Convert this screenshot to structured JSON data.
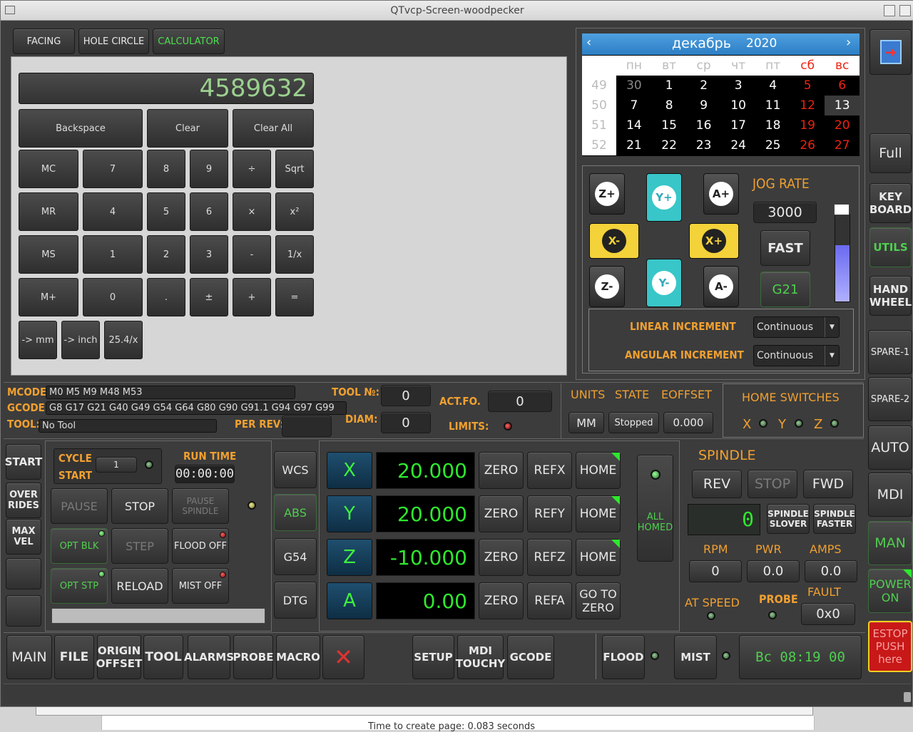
{
  "window": {
    "title": "QTvcp-Screen-woodpecker"
  },
  "tabs": [
    "FACING",
    "HOLE CIRCLE",
    "CALCULATOR"
  ],
  "calculator": {
    "display": "4589632",
    "keys": [
      [
        "Backspace",
        "Clear",
        "Clear All"
      ],
      [
        "MC",
        "7",
        "8",
        "9",
        "÷",
        "Sqrt"
      ],
      [
        "MR",
        "4",
        "5",
        "6",
        "×",
        "x²"
      ],
      [
        "MS",
        "1",
        "2",
        "3",
        "-",
        "1/x"
      ],
      [
        "M+",
        "0",
        ".",
        "±",
        "+",
        "="
      ],
      [
        "-> mm",
        "-> inch",
        "25.4/x"
      ]
    ]
  },
  "calendar": {
    "month": "декабрь",
    "year": "2020",
    "weekdays": [
      "пн",
      "вт",
      "ср",
      "чт",
      "пт",
      "сб",
      "вс"
    ],
    "weeks": [
      {
        "n": "49",
        "d": [
          "30",
          "1",
          "2",
          "3",
          "4",
          "5",
          "6"
        ]
      },
      {
        "n": "50",
        "d": [
          "7",
          "8",
          "9",
          "10",
          "11",
          "12",
          "13"
        ]
      },
      {
        "n": "51",
        "d": [
          "14",
          "15",
          "16",
          "17",
          "18",
          "19",
          "20"
        ]
      },
      {
        "n": "52",
        "d": [
          "21",
          "22",
          "23",
          "24",
          "25",
          "26",
          "27"
        ]
      }
    ]
  },
  "jog": {
    "buttons": {
      "zp": "Z+",
      "yp": "Y+",
      "ap": "A+",
      "xm": "X-",
      "xp": "X+",
      "zm": "Z-",
      "ym": "Y-",
      "am": "A-"
    },
    "rate_label": "JOG RATE",
    "rate": "3000",
    "fast": "FAST",
    "g21": "G21",
    "linear_label": "LINEAR INCREMENT",
    "linear": "Continuous",
    "angular_label": "ANGULAR INCREMENT",
    "angular": "Continuous",
    "slider_level": 0.85
  },
  "right": {
    "full": "Full",
    "keyboard": "KEY BOARD",
    "utils": "UTILS",
    "handwheel": "HAND WHEEL",
    "spare1": "SPARE-1",
    "spare2": "SPARE-2",
    "auto": "AUTO",
    "mdi": "MDI",
    "man": "MAN",
    "power": "POWER ON",
    "estop": "ESTOP PUSH here"
  },
  "status": {
    "mcodes_label": "MCODES:",
    "mcodes": "M0 M5 M9 M48 M53",
    "gcodes_label": "GCODES:",
    "gcodes": "G8 G17 G21 G40 G49 G54 G64 G80 G90 G91.1 G94 G97 G99",
    "tool_label": "TOOL:",
    "tool": "No Tool",
    "toolno_label": "TOOL №:",
    "toolno": "0",
    "diam_label": "DIAM:",
    "diam": "0",
    "perrev_label": "PER REV:",
    "perrev": "",
    "actfo_label": "ACT.FO.",
    "actfo": "0",
    "limits_label": "LIMITS:",
    "units_label": "UNITS",
    "state_label": "STATE",
    "eoffset_label": "EOFFSET",
    "units": "MM",
    "state": "Stopped",
    "eoffset": "0.000",
    "home_label": "HOME SWITCHES",
    "home_axes": [
      "X",
      "Y",
      "Z"
    ]
  },
  "left": {
    "start": "START",
    "overrides": "OVER RIDES",
    "maxvel": "MAX VEL"
  },
  "cycle": {
    "cycle_start": "CYCLE START",
    "count": "1",
    "run_time_label": "RUN TIME",
    "run_time": "00:00:00",
    "pause": "PAUSE",
    "stop": "STOP",
    "pause_spindle": "PAUSE SPINDLE",
    "opt_blk": "OPT BLK",
    "step": "STEP",
    "flood_off": "FLOOD OFF",
    "opt_stp": "OPT STP",
    "reload": "RELOAD",
    "mist_off": "MIST OFF"
  },
  "coords": [
    "WCS",
    "ABS",
    "G54",
    "DTG"
  ],
  "dro": [
    {
      "axis": "X",
      "value": "20.000",
      "ref": "REFX",
      "home": "HOME"
    },
    {
      "axis": "Y",
      "value": "20.000",
      "ref": "REFY",
      "home": "HOME"
    },
    {
      "axis": "Z",
      "value": "-10.000",
      "ref": "REFZ",
      "home": "HOME"
    },
    {
      "axis": "A",
      "value": "0.00",
      "ref": "REFA",
      "home": "GO TO ZERO"
    }
  ],
  "zero": "ZERO",
  "all_homed": "ALL HOMED",
  "spindle": {
    "title": "SPINDLE",
    "rev": "REV",
    "stop": "STOP",
    "fwd": "FWD",
    "speed": "0",
    "slower": "SPINDLE SLOVER",
    "faster": "SPINDLE FASTER",
    "rpm_label": "RPM",
    "pwr_label": "PWR",
    "amps_label": "AMPS",
    "rpm": "0",
    "pwr": "0.0",
    "amps": "0.0",
    "atspeed": "AT SPEED",
    "probe": "PROBE",
    "fault_label": "FAULT",
    "fault": "0x0"
  },
  "bottom": {
    "main": "MAIN",
    "file": "FILE",
    "origin": "ORIGIN OFFSET",
    "tool": "TOOL",
    "alarms": "ALARMS",
    "probe": "PROBE",
    "macro": "MACRO",
    "setup": "SETUP",
    "mdi_touchy": "MDI TOUCHY",
    "gcode": "GCODE",
    "flood": "FLOOD",
    "mist": "MIST",
    "clock": "Вс 08:19 00"
  },
  "behind": {
    "text": "Time to create page: 0.083 seconds"
  }
}
